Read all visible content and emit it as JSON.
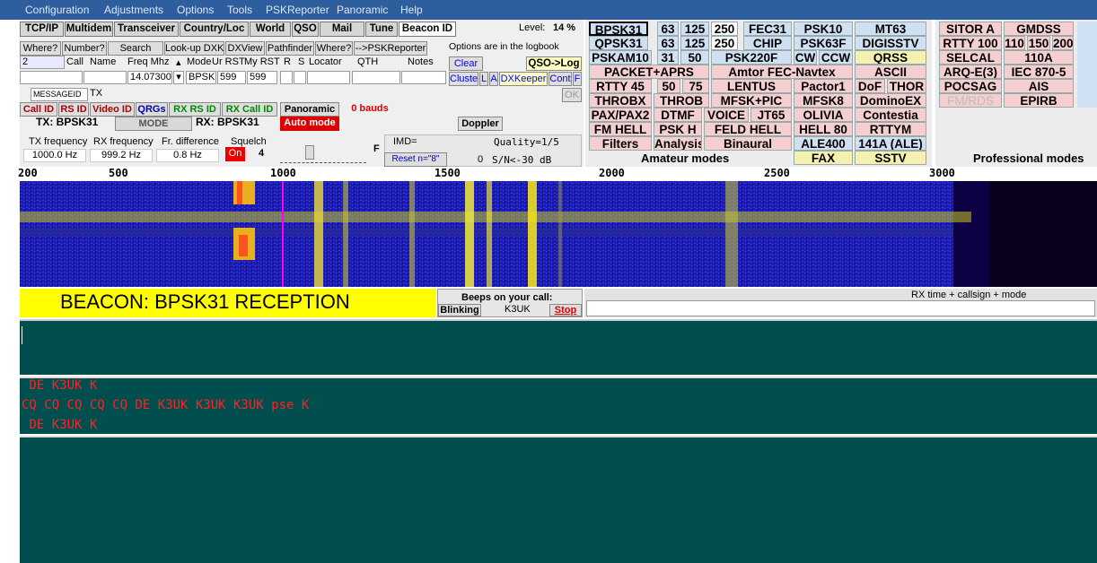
{
  "menu": [
    "Configuration",
    "Adjustments",
    "Options",
    "Tools",
    "PSKReporter",
    "Panoramic",
    "Help"
  ],
  "toolbar": [
    "TCP/IP",
    "Multidem",
    "Transceiver",
    "Country/Loc",
    "World",
    "QSO",
    "Mail",
    "Tune",
    "Beacon ID"
  ],
  "level": {
    "label": "Level:",
    "value": "14 %"
  },
  "row2": [
    "Where?",
    "Number?",
    "Search",
    "Look-up DXK",
    "DXView",
    "Pathfinder",
    "Where?",
    "-->PSKReporter"
  ],
  "logbook_note": "Options are in the logbook",
  "qso_headers": [
    "Call",
    "Name",
    "Freq Mhz",
    "Mode",
    "Ur RST",
    "My RST",
    "R",
    "S",
    "Locator",
    "QTH",
    "Notes"
  ],
  "qso_values": {
    "counter": "2",
    "freq": "14.07300",
    "mode": "BPSK",
    "ur_rst": "599",
    "my_rst": "599"
  },
  "qso_buttons": [
    "Clear",
    "QSO->Log",
    "Cluster",
    "L",
    "A",
    "DXKeeper",
    "Cont",
    "F"
  ],
  "msgid": {
    "label": "MESSAGEID",
    "tx": "TX",
    "ok": "OK"
  },
  "idbuttons": [
    "Call ID",
    "RS ID",
    "Video ID",
    "QRGs",
    "RX RS ID",
    "RX Call ID"
  ],
  "panoramic": {
    "label": "Panoramic",
    "auto": "Auto mode",
    "bauds": "0 bauds"
  },
  "txrx": {
    "tx": "TX: BPSK31",
    "rx": "RX: BPSK31",
    "mode": "MODE",
    "doppler": "Doppler"
  },
  "freq": {
    "tx_label": "TX frequency",
    "tx": "1000.0 Hz",
    "rx_label": "RX frequency",
    "rx": "999.2 Hz",
    "diff_label": "Fr. difference",
    "diff": "0.8 Hz"
  },
  "squelch": {
    "label": "Squelch",
    "on": "On",
    "value": "4",
    "f": "F"
  },
  "imd": {
    "label": "IMD=",
    "quality": "Quality=1/5",
    "reset": "Reset n=\"8\"",
    "zero": "0",
    "sn": "S/N<-30 dB"
  },
  "modes": [
    [
      "BPSK31",
      "63",
      "125",
      "250",
      "FEC31",
      "PSK10",
      "MT63"
    ],
    [
      "QPSK31",
      "63",
      "125",
      "250",
      "CHIP",
      "PSK63F",
      "DIGISSTV"
    ],
    [
      "PSKAM10",
      "31",
      "50",
      "PSK220F",
      "CW",
      "CCW",
      "QRSS"
    ],
    [
      "PACKET+APRS",
      "Amtor FEC-Navtex",
      "ASCII"
    ],
    [
      "RTTY 45",
      "50",
      "75",
      "LENTUS",
      "Pactor1",
      "DoF",
      "THOR"
    ],
    [
      "THROBX",
      "THROB",
      "MFSK+PIC",
      "MFSK8",
      "DominoEX"
    ],
    [
      "PAX/PAX2",
      "DTMF",
      "VOICE",
      "JT65",
      "OLIVIA",
      "Contestia"
    ],
    [
      "FM HELL",
      "PSK H",
      "FELD HELL",
      "HELL 80",
      "RTTYM"
    ],
    [
      "Filters",
      "Analysis",
      "Binaural",
      "ALE400",
      "141A (ALE)"
    ],
    [
      "Amateur modes",
      "FAX",
      "SSTV"
    ]
  ],
  "pro_modes": [
    "SITOR A",
    "GMDSS",
    "RTTY 100",
    "110",
    "150",
    "200",
    "SELCAL",
    "110A",
    "ARQ-E(3)",
    "IEC 870-5",
    "POCSAG",
    "AIS",
    "FM/RDS",
    "EPIRB",
    "Professional modes"
  ],
  "ruler": [
    "200",
    "500",
    "1000",
    "1500",
    "2000",
    "2500",
    "3000"
  ],
  "beacon": "BEACON: BPSK31 RECEPTION",
  "beeps": {
    "title": "Beeps on your call:",
    "blink": "Blinking",
    "call": "K3UK",
    "stop": "Stop"
  },
  "rxlog_title": "RX time + callsign + mode",
  "rx_lines": [
    " DE K3UK K",
    "CQ CQ CQ CQ CQ DE K3UK K3UK K3UK pse K",
    " DE K3UK K"
  ]
}
